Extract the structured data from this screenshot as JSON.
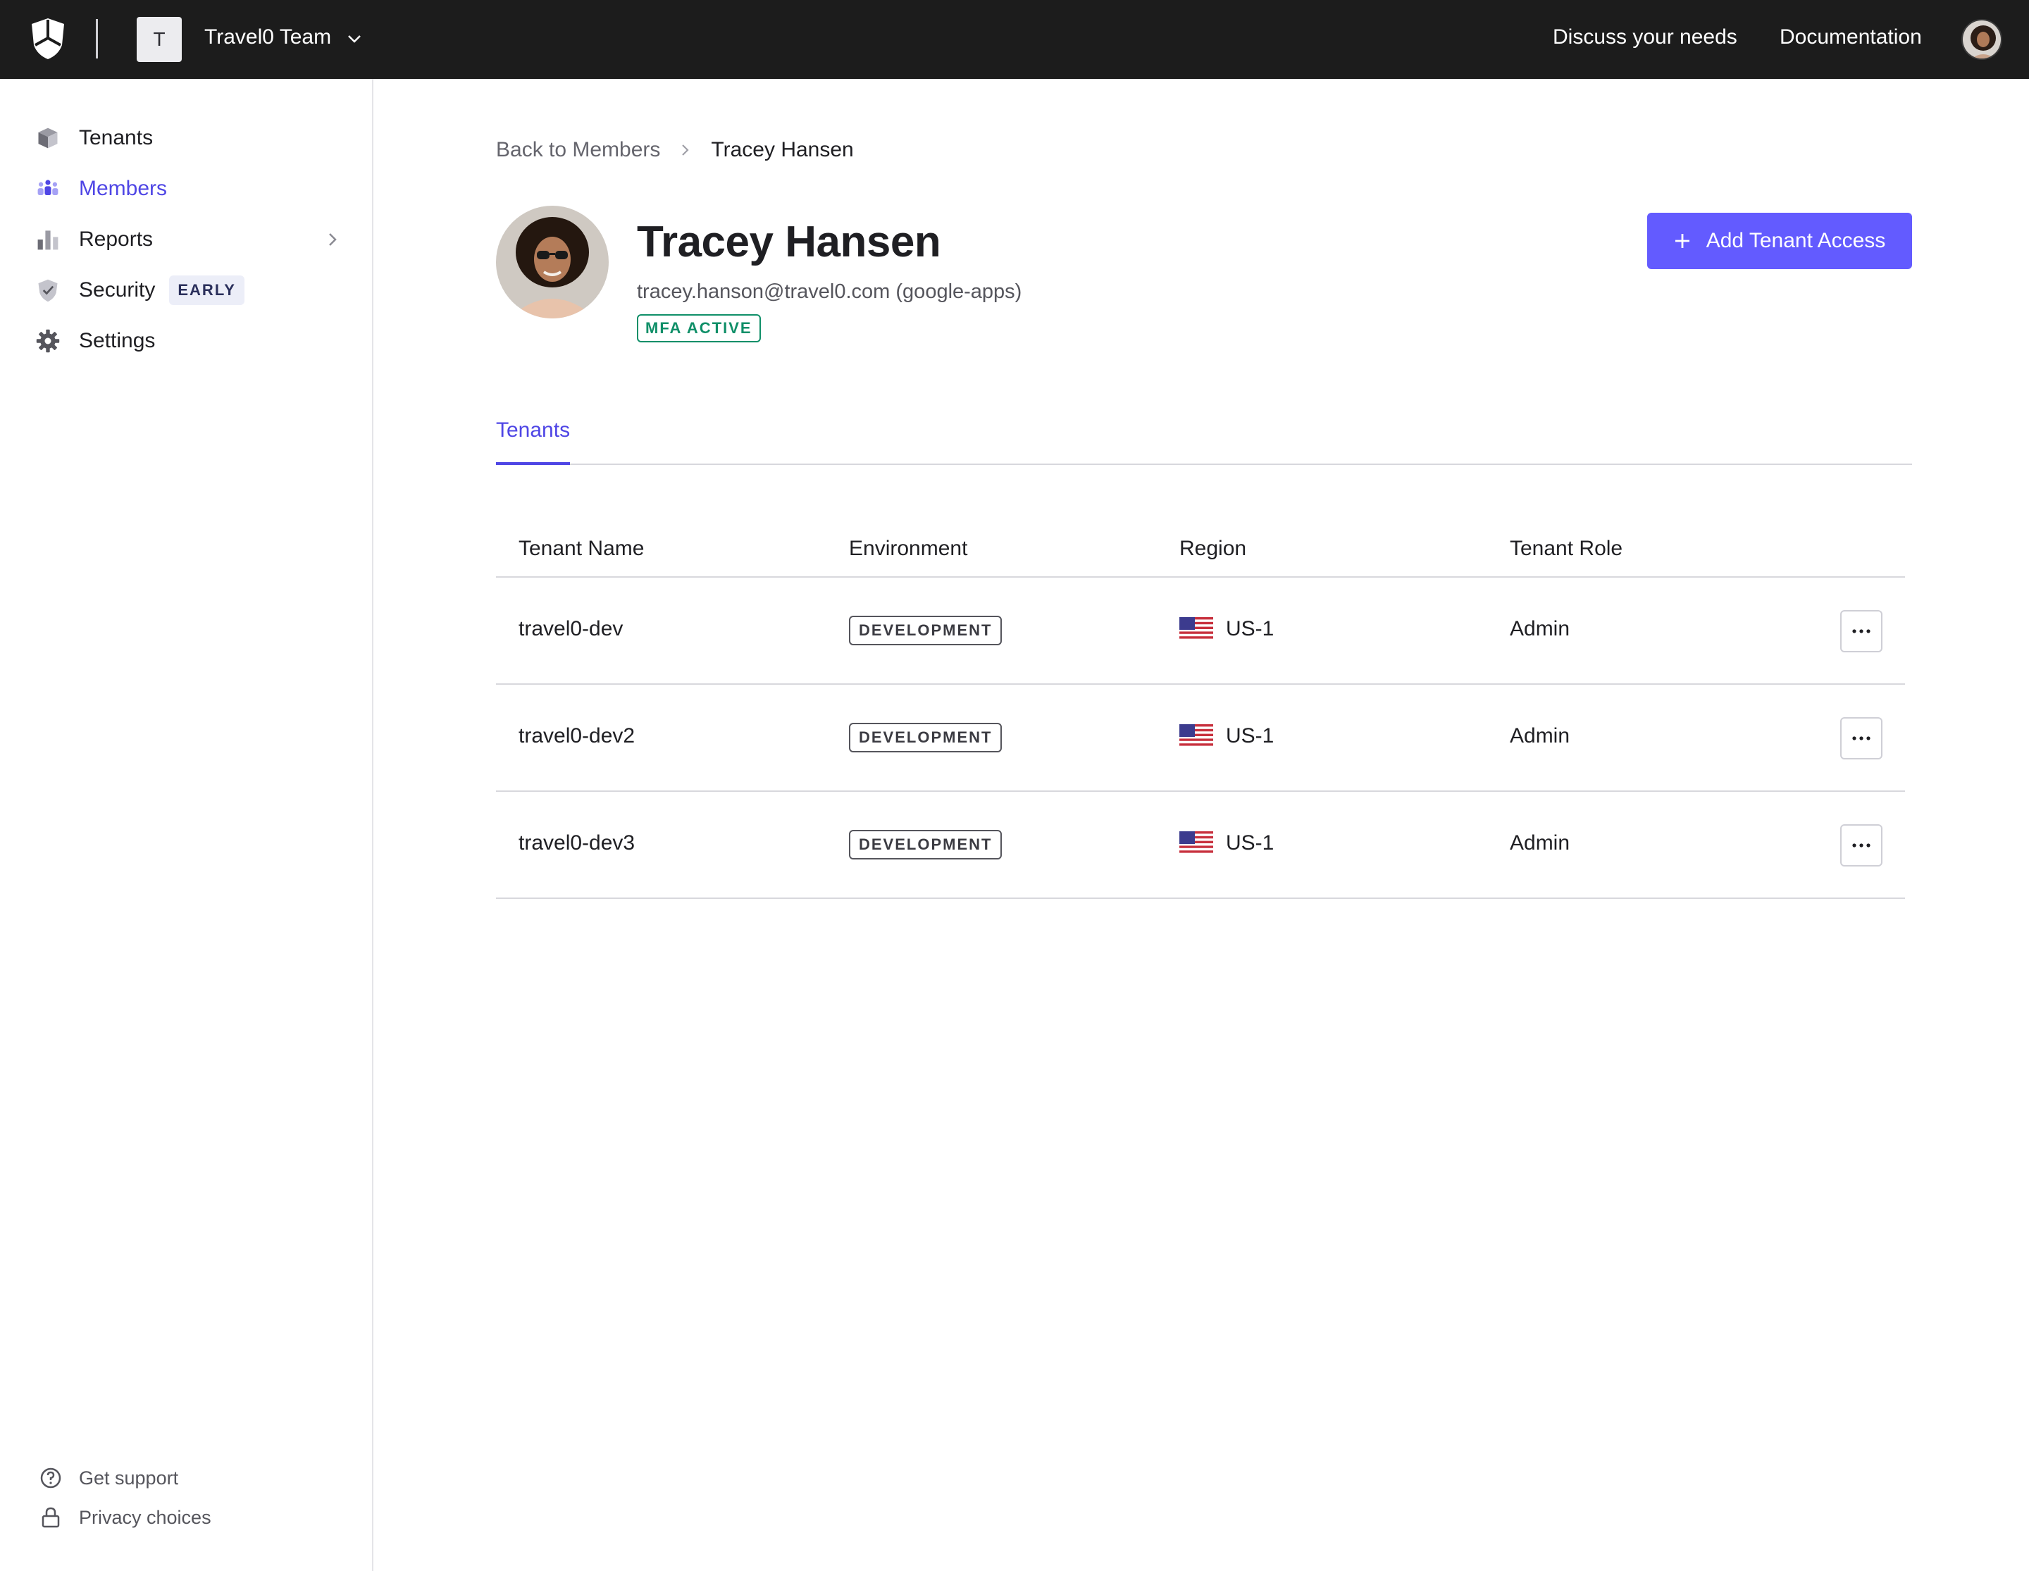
{
  "topbar": {
    "tenant_initial": "T",
    "team_name": "Travel0 Team",
    "links": [
      "Discuss your needs",
      "Documentation"
    ]
  },
  "sidebar": {
    "items": [
      {
        "label": "Tenants",
        "icon": "cube-icon"
      },
      {
        "label": "Members",
        "icon": "members-icon",
        "active": true
      },
      {
        "label": "Reports",
        "icon": "bar-chart-icon",
        "has_submenu": true
      },
      {
        "label": "Security",
        "icon": "shield-check-icon",
        "badge": "EARLY"
      },
      {
        "label": "Settings",
        "icon": "gear-icon"
      }
    ],
    "footer": [
      {
        "label": "Get support",
        "icon": "help-circle-icon"
      },
      {
        "label": "Privacy choices",
        "icon": "lock-icon"
      }
    ]
  },
  "breadcrumb": {
    "back": "Back to Members",
    "current": "Tracey Hansen"
  },
  "member": {
    "name": "Tracey Hansen",
    "email": "tracey.hanson@travel0.com (google-apps)",
    "mfa_status": "MFA ACTIVE"
  },
  "actions": {
    "add_tenant_access": "Add Tenant Access"
  },
  "tabs": [
    "Tenants"
  ],
  "table": {
    "columns": [
      "Tenant Name",
      "Environment",
      "Region",
      "Tenant Role"
    ],
    "rows": [
      {
        "tenant": "travel0-dev",
        "environment": "DEVELOPMENT",
        "region": "US-1",
        "role": "Admin"
      },
      {
        "tenant": "travel0-dev2",
        "environment": "DEVELOPMENT",
        "region": "US-1",
        "role": "Admin"
      },
      {
        "tenant": "travel0-dev3",
        "environment": "DEVELOPMENT",
        "region": "US-1",
        "role": "Admin"
      }
    ]
  },
  "colors": {
    "topbar_bg": "#1c1c1c",
    "accent": "#635bff",
    "active_nav": "#4f46e5",
    "mfa_green": "#0f8f68"
  }
}
